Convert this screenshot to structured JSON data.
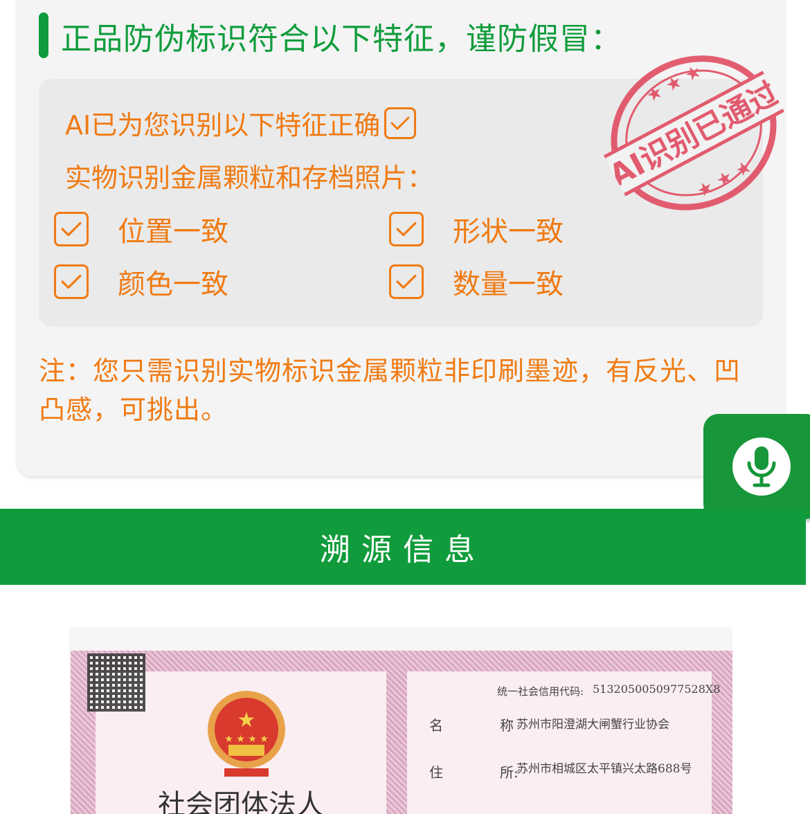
{
  "features_section": {
    "title": "正品防伪标识符合以下特征，谨防假冒：",
    "ai_line": "AI已为您识别以下特征正确",
    "subtitle": "实物识别金属颗粒和存档照片：",
    "features": [
      {
        "label": "位置一致",
        "checked": true
      },
      {
        "label": "形状一致",
        "checked": true
      },
      {
        "label": "颜色一致",
        "checked": true
      },
      {
        "label": "数量一致",
        "checked": true
      }
    ],
    "note": "注：您只需识别实物标识金属颗粒非印刷墨迹，有反光、凹凸感，可挑出。",
    "stamp_text": "AI识别已通过"
  },
  "voice_button": {
    "icon": "microphone-icon"
  },
  "trace_banner": {
    "title": "溯源信息"
  },
  "certificate": {
    "credit_code_label": "统一社会信用代码:",
    "credit_code": "5132050050977528X8",
    "name_label_1": "名",
    "name_label_2": "称",
    "name_value": "苏州市阳澄湖大闸蟹行业协会",
    "address_label_1": "住",
    "address_label_2": "所:",
    "address_value": "苏州市相城区太平镇兴太路688号",
    "heading": "社会团体法人"
  },
  "colors": {
    "brand_green": "#109c3c",
    "accent_orange": "#f07a12",
    "stamp_red": "#e0435a"
  }
}
